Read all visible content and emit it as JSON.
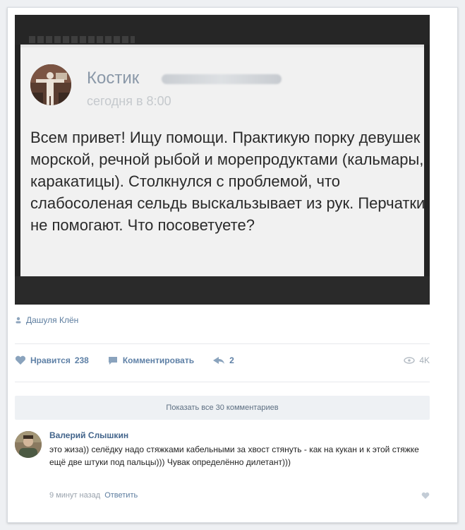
{
  "post": {
    "author": "Костик",
    "time": "сегодня в 8:00",
    "text": "Всем привет! Ищу помощи. Практикую порку девушек морской, речной рыбой и морепродуктами (кальмары, каракатицы). Столкнулся с проблемой, что слабосоленая сельдь выскальзывает из рук. Перчатки не помогают. Что посоветуете?"
  },
  "source_author": "Дашуля Клён",
  "actions": {
    "like_label": "Нравится",
    "like_count": "238",
    "comment_label": "Комментировать",
    "share_count": "2",
    "views": "4K"
  },
  "show_all": "Показать все 30 комментариев",
  "comment": {
    "author": "Валерий Слышкин",
    "text": "это жиза)) селёдку надо стяжками кабельными за хвост стянуть - как на кукан и к этой стяжке ещё две штуки под пальцы))) Чувак определённо дилетант)))",
    "time": "9 минут назад",
    "reply_label": "Ответить"
  },
  "colors": {
    "link": "#42648b",
    "action": "#5e80a6",
    "muted": "#9aa3ad"
  },
  "icons": [
    "user-icon",
    "heart-icon",
    "comment-icon",
    "share-icon",
    "eye-icon",
    "like-heart-icon"
  ]
}
